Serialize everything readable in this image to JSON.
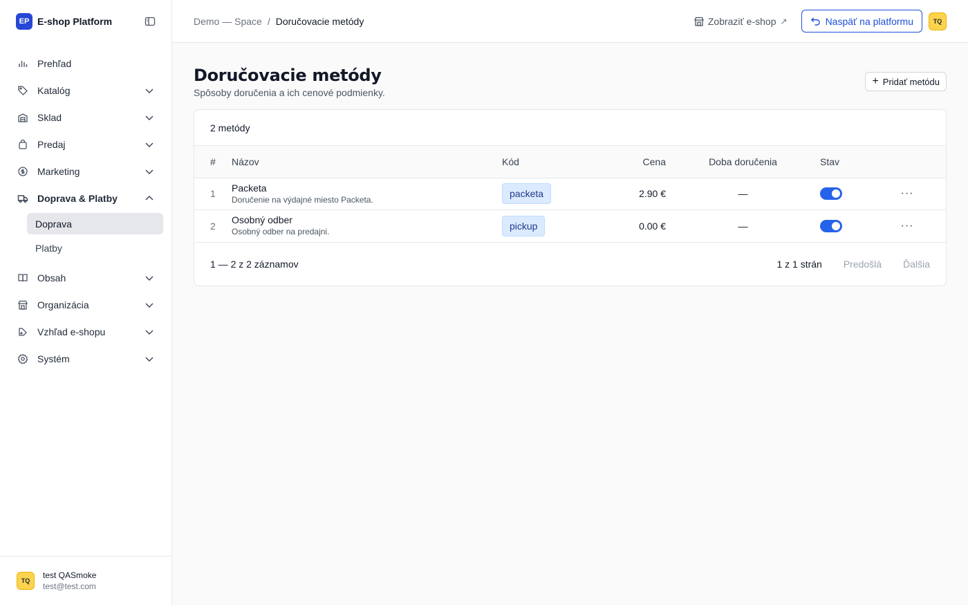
{
  "brand": {
    "logo": "EP",
    "name": "E-shop Platform"
  },
  "nav": [
    {
      "label": "Prehľad",
      "icon": "bar-chart-icon",
      "chevron": false
    },
    {
      "label": "Katalóg",
      "icon": "tag-icon",
      "chevron": true
    },
    {
      "label": "Sklad",
      "icon": "warehouse-icon",
      "chevron": true
    },
    {
      "label": "Predaj",
      "icon": "shopping-bag-icon",
      "chevron": true
    },
    {
      "label": "Marketing",
      "icon": "dollar-circle-icon",
      "chevron": true
    },
    {
      "label": "Doprava & Platby",
      "icon": "truck-icon",
      "chevron": true,
      "open": true
    },
    {
      "label": "Obsah",
      "icon": "book-icon",
      "chevron": true
    },
    {
      "label": "Organizácia",
      "icon": "store-icon",
      "chevron": true
    },
    {
      "label": "Vzhľad e-shopu",
      "icon": "palette-icon",
      "chevron": true
    },
    {
      "label": "Systém",
      "icon": "settings-icon",
      "chevron": true
    }
  ],
  "subnav": [
    {
      "label": "Doprava",
      "active": true
    },
    {
      "label": "Platby",
      "active": false
    }
  ],
  "user": {
    "initials": "TQ",
    "name": "test QASmoke",
    "email": "test@test.com"
  },
  "breadcrumb": {
    "parent": "Demo — Space",
    "separator": "/",
    "current": "Doručovacie metódy"
  },
  "topbar": {
    "view_shop": "Zobraziť e-shop",
    "external": "↗",
    "back": "Naspäť na platformu",
    "avatar": "TQ"
  },
  "page": {
    "title": "Doručovacie metódy",
    "subtitle": "Spôsoby doručenia a ich cenové podmienky.",
    "add_button": "Pridať metódu",
    "add_plus": "+"
  },
  "table": {
    "count_label": "2 metódy",
    "headers": {
      "num": "#",
      "name": "Názov",
      "code": "Kód",
      "price": "Cena",
      "time": "Doba doručenia",
      "status": "Stav"
    },
    "rows": [
      {
        "num": "1",
        "name": "Packeta",
        "desc": "Doručenie na výdajné miesto Packeta.",
        "code": "packeta",
        "price": "2.90 €",
        "time": "—",
        "active": true,
        "more": "···"
      },
      {
        "num": "2",
        "name": "Osobný odber",
        "desc": "Osobný odber na predajni.",
        "code": "pickup",
        "price": "0.00 €",
        "time": "—",
        "active": true,
        "more": "···"
      }
    ],
    "footer": {
      "range": "1 — 2 z 2 záznamov",
      "pages": "1 z 1 strán",
      "prev": "Predošlá",
      "next": "Ďalšia"
    }
  }
}
